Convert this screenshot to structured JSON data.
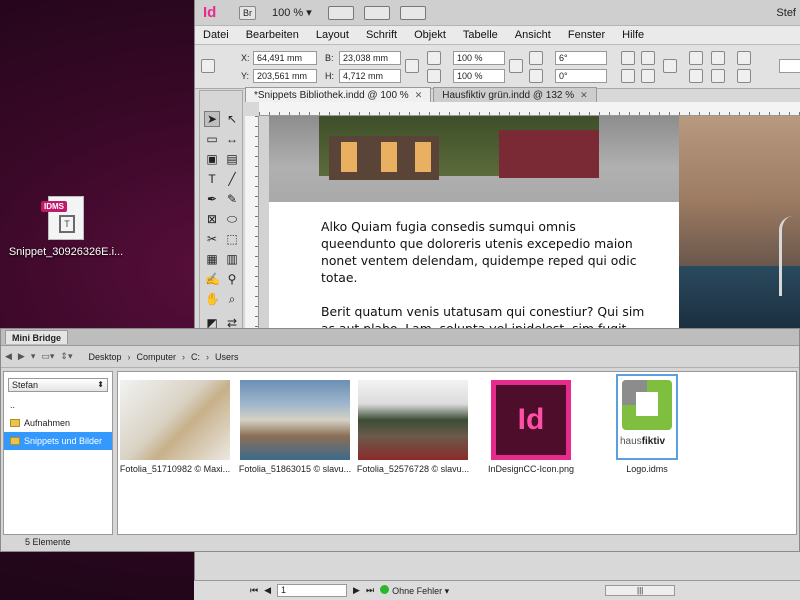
{
  "desktop": {
    "icon_label": "Snippet_30926326E.i...",
    "icon_tag": "IDMS",
    "icon_mark": "T"
  },
  "app": {
    "logo": "Id",
    "bridge_button": "Br",
    "zoom": "100 %",
    "user": "Stef"
  },
  "menu": [
    "Datei",
    "Bearbeiten",
    "Layout",
    "Schrift",
    "Objekt",
    "Tabelle",
    "Ansicht",
    "Fenster",
    "Hilfe"
  ],
  "control": {
    "x_label": "X:",
    "x_value": "64,491 mm",
    "y_label": "Y:",
    "y_value": "203,561 mm",
    "b_label": "B:",
    "b_value": "23,038 mm",
    "h_label": "H:",
    "h_value": "4,712 mm",
    "scale_x": "100 %",
    "scale_y": "100 %",
    "angle": "6°",
    "shear": "0°"
  },
  "doc_tabs": [
    {
      "label": "*Snippets Bibliothek.indd @ 100 %",
      "active": true
    },
    {
      "label": "Hausfiktiv grün.indd @ 132 %",
      "active": false
    }
  ],
  "document": {
    "paragraphs": [
      "Alko Quiam fugia consedis sumqui omnis queendunto que doloreris utenis excepedio maion nonet ventem delendam, quidempe reped qui odic totae.",
      "Berit quatum venis utatusam qui conestiur? Qui sim as aut plabo. Lam, solupta vel ipidelest, sim fugit, vellabo rporempost, sit acepuda pianduntin cum conet utet"
    ]
  },
  "minibridge": {
    "tab": "Mini Bridge",
    "breadcrumb": [
      "Desktop",
      "Computer",
      "C:",
      "Users"
    ],
    "user_select": "Stefan",
    "tree": [
      {
        "label": "..",
        "folder": false,
        "selected": false
      },
      {
        "label": "Aufnahmen",
        "folder": true,
        "selected": false
      },
      {
        "label": "Snippets und Bilder",
        "folder": true,
        "selected": true
      }
    ],
    "items": [
      "Fotolia_51710982 © Maxi...",
      "Fotolia_51863015 © slavu...",
      "Fotolia_52576728 © slavu...",
      "InDesignCC-Icon.png",
      "Logo.idms"
    ],
    "logo_text_a": "haus",
    "logo_text_b": "fiktiv",
    "id_icon_text": "Id",
    "status": "5 Elemente"
  },
  "statusbar": {
    "page": "1",
    "preflight": "Ohne Fehler"
  }
}
